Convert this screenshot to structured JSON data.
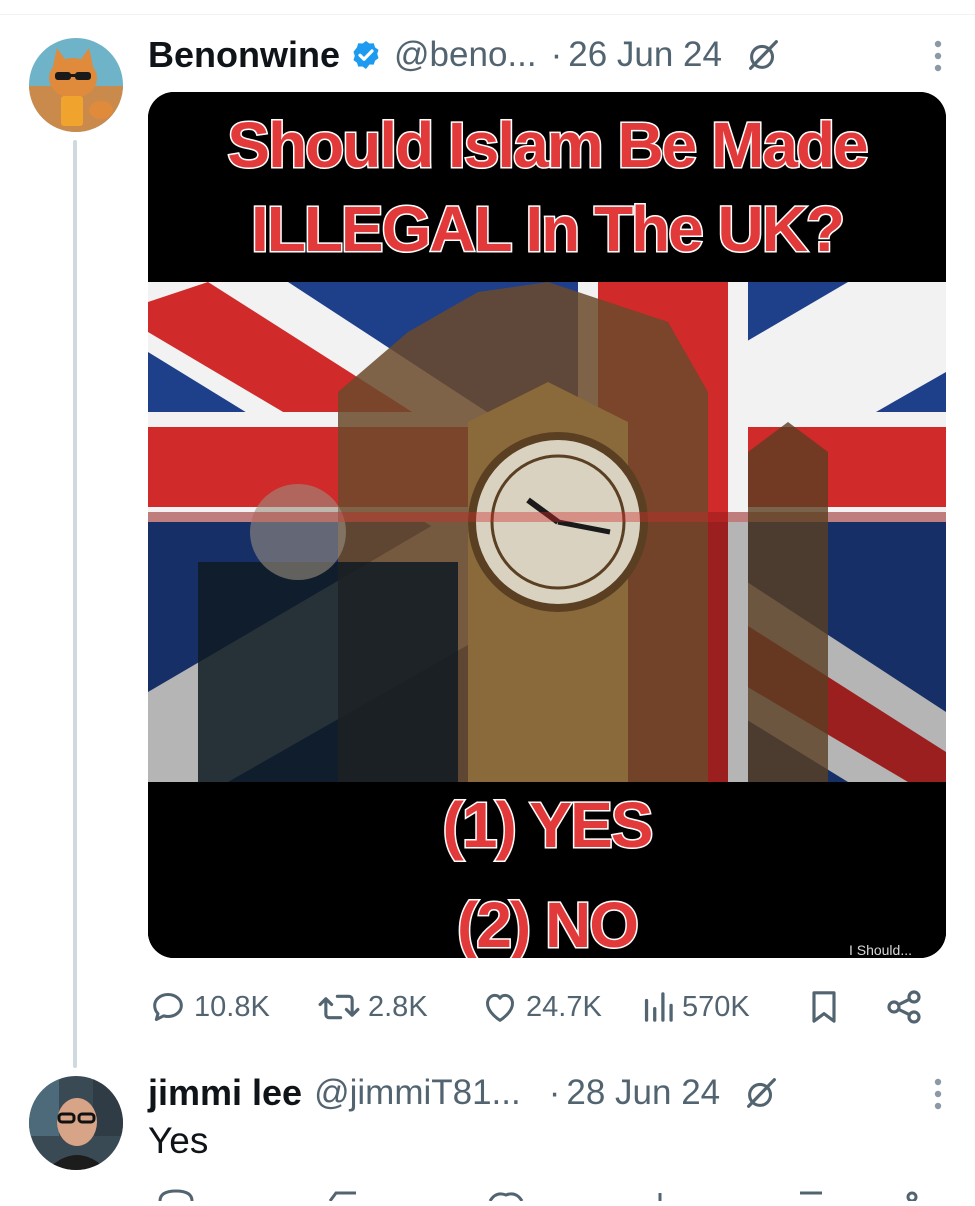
{
  "tweet": {
    "display_name": "Benonwine",
    "handle": "@beno...",
    "separator": "·",
    "date": "26 Jun 24",
    "verified": true,
    "avatar_icon": "cat-with-drink-avatar",
    "media": {
      "line1": "Should Islam Be Made",
      "line2": "ILLEGAL In The UK?",
      "option1": "(1) YES",
      "option2": "(2) NO",
      "watermark": "I Should..."
    },
    "stats": {
      "replies": "10.8K",
      "retweets": "2.8K",
      "likes": "24.7K",
      "views": "570K"
    }
  },
  "reply": {
    "display_name": "jimmi lee",
    "handle": "@jimmiT81...",
    "separator": "·",
    "date": "28 Jun 24",
    "avatar_icon": "man-with-glasses-avatar",
    "text": "Yes"
  },
  "colors": {
    "verified_blue": "#1d9bf0",
    "muted": "#536471",
    "meme_red": "#e23a3a"
  }
}
